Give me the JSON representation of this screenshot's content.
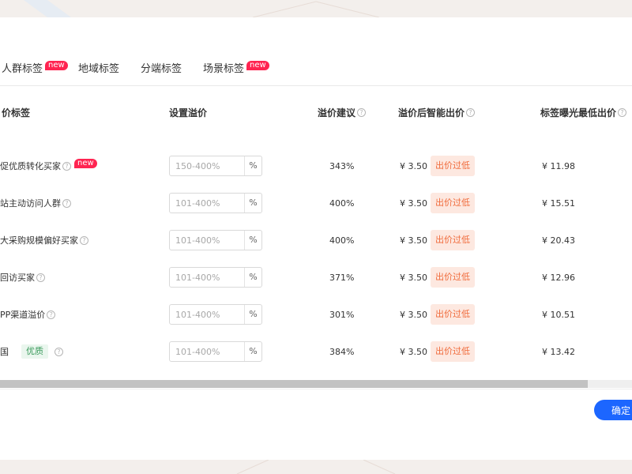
{
  "tabs": [
    {
      "label": "人群标签",
      "badge": "new"
    },
    {
      "label": "地域标签",
      "badge": ""
    },
    {
      "label": "分端标签",
      "badge": ""
    },
    {
      "label": "场景标签",
      "badge": "new"
    }
  ],
  "table": {
    "headers": {
      "tag": "价标签",
      "premium": "设置溢价",
      "suggest": "溢价建议",
      "smart_bid": "溢价后智能出价",
      "min_bid": "标签曝光最低出价"
    },
    "percent_suffix": "%",
    "low_label": "出价过低",
    "rows": [
      {
        "tag": "促优质转化买家",
        "help": true,
        "badge": "new",
        "quality": "",
        "placeholder": "150-400%",
        "suggest": "343%",
        "price": "¥ 3.50",
        "min": "¥ 11.98"
      },
      {
        "tag": "站主动访问人群",
        "help": true,
        "badge": "",
        "quality": "",
        "placeholder": "101-400%",
        "suggest": "400%",
        "price": "¥ 3.50",
        "min": "¥ 15.51"
      },
      {
        "tag": "大采购规模偏好买家",
        "help": true,
        "badge": "",
        "quality": "",
        "placeholder": "101-400%",
        "suggest": "400%",
        "price": "¥ 3.50",
        "min": "¥ 20.43"
      },
      {
        "tag": "回访买家",
        "help": true,
        "badge": "",
        "quality": "",
        "placeholder": "101-400%",
        "suggest": "371%",
        "price": "¥ 3.50",
        "min": "¥ 12.96"
      },
      {
        "tag": "PP渠道溢价",
        "help": true,
        "badge": "",
        "quality": "",
        "placeholder": "101-400%",
        "suggest": "301%",
        "price": "¥ 3.50",
        "min": "¥ 10.51"
      },
      {
        "tag": "国",
        "help": true,
        "badge": "",
        "quality": "优质",
        "placeholder": "101-400%",
        "suggest": "384%",
        "price": "¥ 3.50",
        "min": "¥ 13.42"
      }
    ]
  },
  "scrollbar": {
    "position": 0.0,
    "visible_fraction": 0.93
  },
  "confirm_label": "确定",
  "colors": {
    "accent": "#1c66ff",
    "new_badge": "#ff2451",
    "low_badge_bg": "#fde8e0",
    "low_badge_text": "#f06a3a",
    "quality_bg": "#eaf6ee",
    "quality_text": "#3a9a5b"
  }
}
